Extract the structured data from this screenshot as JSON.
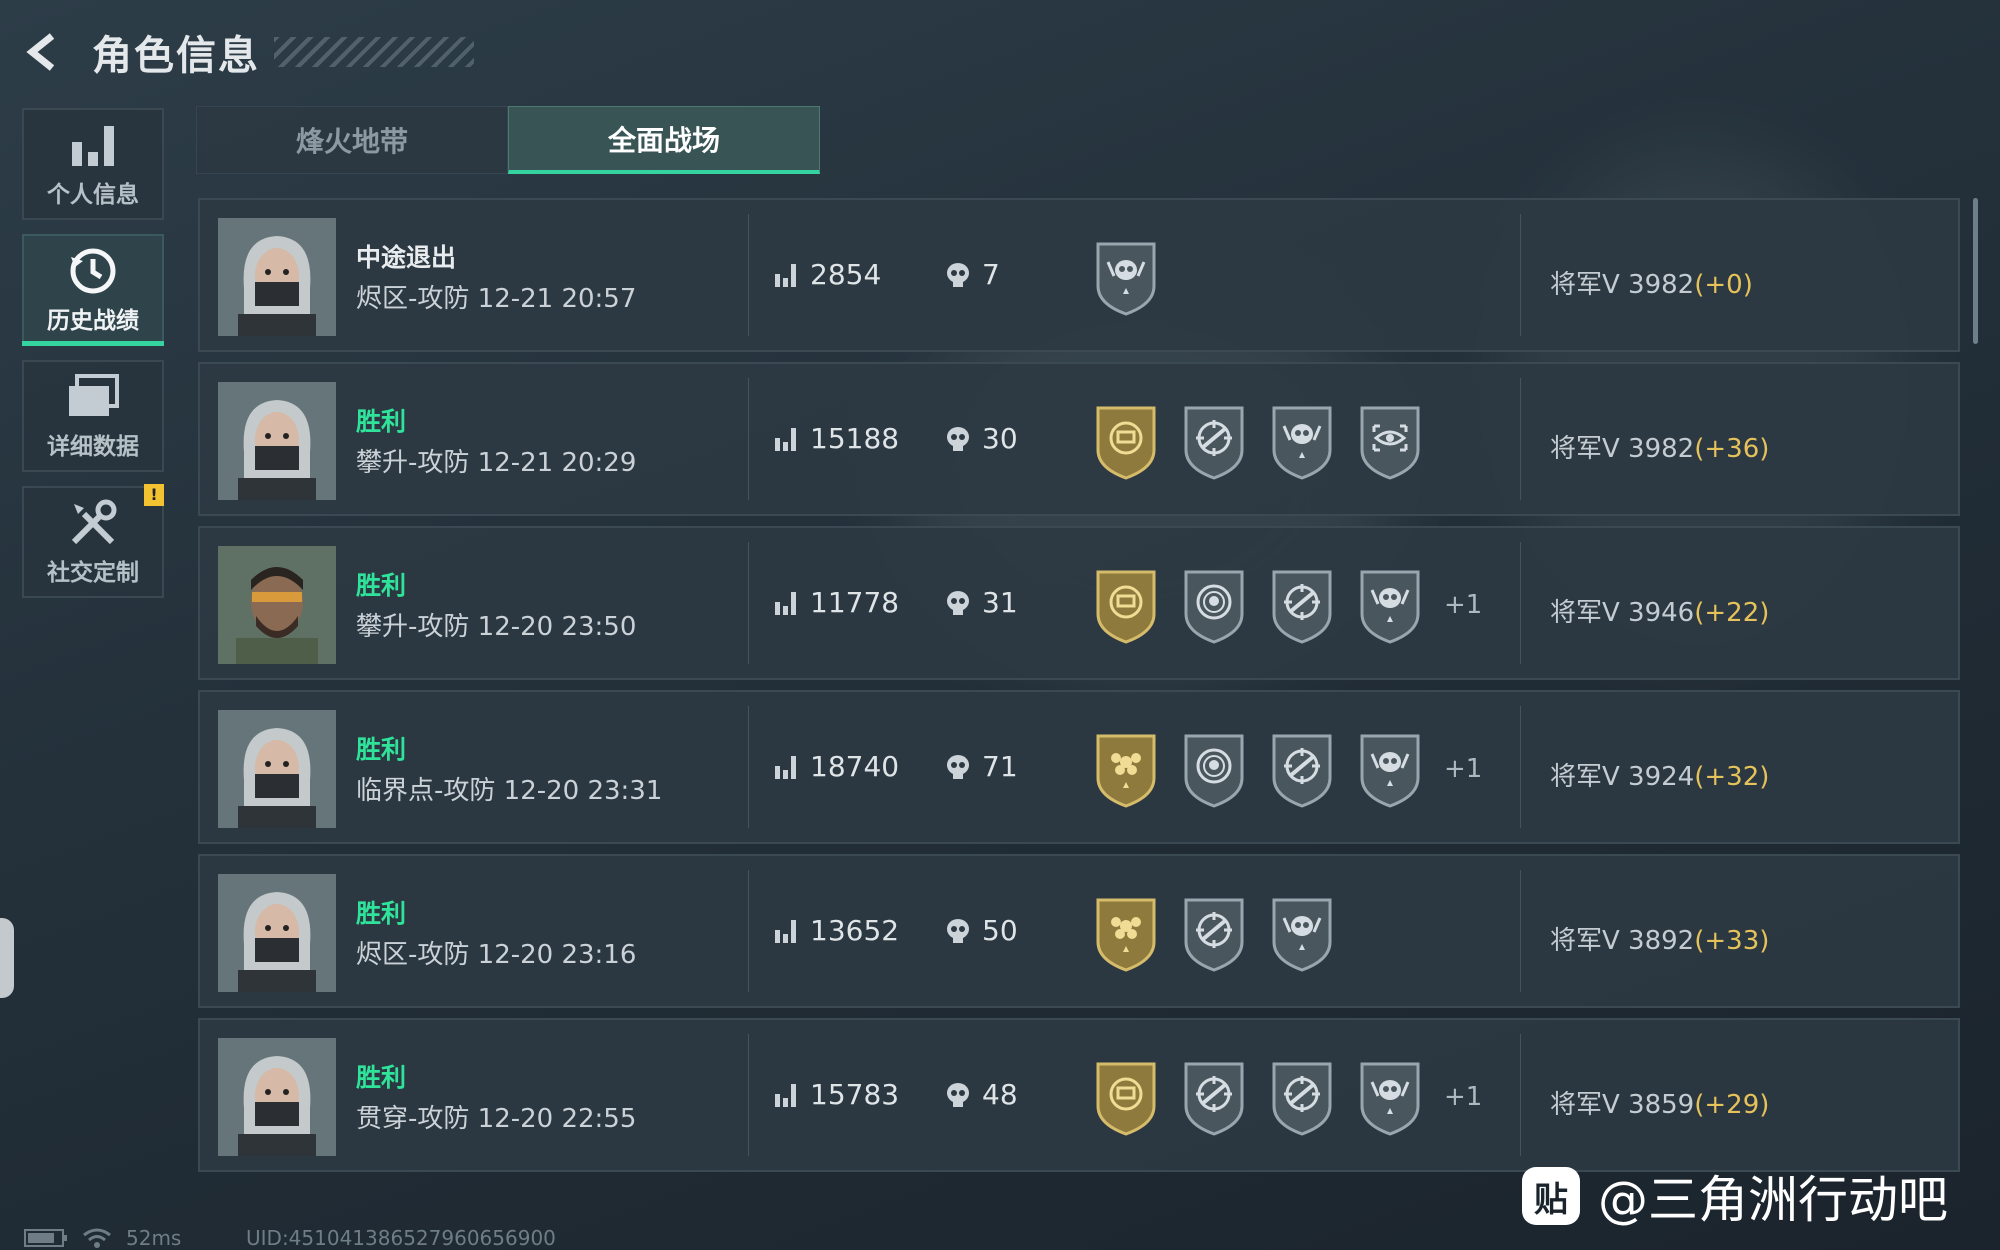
{
  "header": {
    "title": "角色信息"
  },
  "sidebar": {
    "items": [
      {
        "label": "个人信息",
        "icon": "bar-chart-icon",
        "active": false
      },
      {
        "label": "历史战绩",
        "icon": "history-clock-icon",
        "active": true
      },
      {
        "label": "详细数据",
        "icon": "folder-icon",
        "active": false
      },
      {
        "label": "社交定制",
        "icon": "tools-icon",
        "active": false,
        "badge": "!"
      }
    ]
  },
  "tabs": [
    {
      "label": "烽火地带",
      "active": false
    },
    {
      "label": "全面战场",
      "active": true
    }
  ],
  "matches": [
    {
      "result": "中途退出",
      "map": "烬区-攻防 12-21 20:57",
      "score": "2854",
      "kills": "7",
      "badges": [
        "skull-emblem"
      ],
      "extra": "",
      "rank": "将军V 3982",
      "delta": "(+0)"
    },
    {
      "result": "胜利",
      "map": "攀升-攻防 12-21 20:29",
      "score": "15188",
      "kills": "30",
      "badges": [
        "gold-medal",
        "crosshair-rifle",
        "skull-emblem",
        "eye-scope"
      ],
      "extra": "",
      "rank": "将军V 3982",
      "delta": "(+36)"
    },
    {
      "result": "胜利",
      "map": "攀升-攻防 12-20 23:50",
      "score": "11778",
      "kills": "31",
      "badges": [
        "gold-medal",
        "target-skull",
        "crosshair-rifle",
        "skull-emblem"
      ],
      "extra": "+1",
      "rank": "将军V 3946",
      "delta": "(+22)"
    },
    {
      "result": "胜利",
      "map": "临界点-攻防 12-20 23:31",
      "score": "18740",
      "kills": "71",
      "badges": [
        "gold-flower",
        "target-skull",
        "crosshair-rifle",
        "skull-emblem"
      ],
      "extra": "+1",
      "rank": "将军V 3924",
      "delta": "(+32)"
    },
    {
      "result": "胜利",
      "map": "烬区-攻防 12-20 23:16",
      "score": "13652",
      "kills": "50",
      "badges": [
        "gold-flower",
        "crosshair-rifle",
        "skull-emblem"
      ],
      "extra": "",
      "rank": "将军V 3892",
      "delta": "(+33)"
    },
    {
      "result": "胜利",
      "map": "贯穿-攻防 12-20 22:55",
      "score": "15783",
      "kills": "48",
      "badges": [
        "gold-medal",
        "crosshair-rifle",
        "crosshair-rifle",
        "skull-emblem"
      ],
      "extra": "+1",
      "rank": "将军V 3859",
      "delta": "(+29)"
    }
  ],
  "status": {
    "ping": "52ms",
    "uid": "UID:451041386527960656900"
  },
  "watermark": {
    "logo": "贴",
    "text": "@三角洲行动吧"
  },
  "colors": {
    "accent": "#34d3a0",
    "win": "#2fe39a",
    "delta": "#e6c35a",
    "gold": "#b89a4e"
  }
}
